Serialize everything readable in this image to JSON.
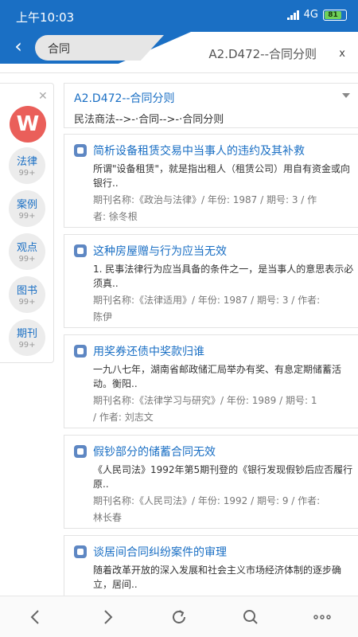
{
  "status": {
    "time": "上午10:03",
    "network": "4G",
    "battery": "81"
  },
  "header": {
    "search_value": "合同",
    "title": "A2.D472--合同分则",
    "close": "x"
  },
  "sidebar": {
    "logo": "W",
    "items": [
      {
        "label": "法律",
        "count": "99+"
      },
      {
        "label": "案例",
        "count": "99+"
      },
      {
        "label": "观点",
        "count": "99+"
      },
      {
        "label": "图书",
        "count": "99+"
      },
      {
        "label": "期刊",
        "count": "99+"
      }
    ]
  },
  "category": {
    "title": "A2.D472--合同分则",
    "path": "民法商法-->-·合同-->-·合同分则"
  },
  "results": [
    {
      "title": "简析设备租赁交易中当事人的违约及其补救",
      "snippet": "所谓\"设备租赁\"，就是指出租人（租赁公司）用自有资金或向银行..",
      "meta_line1": "期刊名称:《政治与法律》/ 年份: 1987 / 期号: 3 / 作",
      "meta_line2": "者: 徐冬根"
    },
    {
      "title": "这种房屋赠与行为应当无效",
      "snippet": "1. 民事法律行为应当具备的条件之一，是当事人的意思表示必须真..",
      "meta_line1": "期刊名称:《法律适用》/ 年份: 1987 / 期号: 3 / 作者:",
      "meta_line2": "陈伊"
    },
    {
      "title": "用奖券还债中奖款归谁",
      "snippet": "一九八七年，湖南省邮政储汇局举办有奖、有息定期储蓄活动。衡阳..",
      "meta_line1": "期刊名称:《法律学习与研究》/ 年份: 1989 / 期号: 1",
      "meta_line2": "/ 作者: 刘志文"
    },
    {
      "title": "假钞部分的储蓄合同无效",
      "snippet": "《人民司法》1992年第5期刊登的《银行发现假钞后应否履行原..",
      "meta_line1": "期刊名称:《人民司法》/ 年份: 1992 / 期号: 9 / 作者:",
      "meta_line2": "林长春"
    },
    {
      "title": "谈居间合同纠纷案件的审理",
      "snippet": "随着改革开放的深入发展和社会主义市场经济体制的逐步确立，居间..",
      "meta_line1": "",
      "meta_line2": ""
    }
  ],
  "icons": [
    "back-icon",
    "forward-icon",
    "refresh-icon",
    "search-icon",
    "more-icon",
    "close-icon",
    "dropdown-arrow-icon",
    "document-icon"
  ],
  "colors": {
    "brand": "#1a6fc4",
    "logo": "#ea5f5a",
    "link": "#1a6fc4"
  }
}
